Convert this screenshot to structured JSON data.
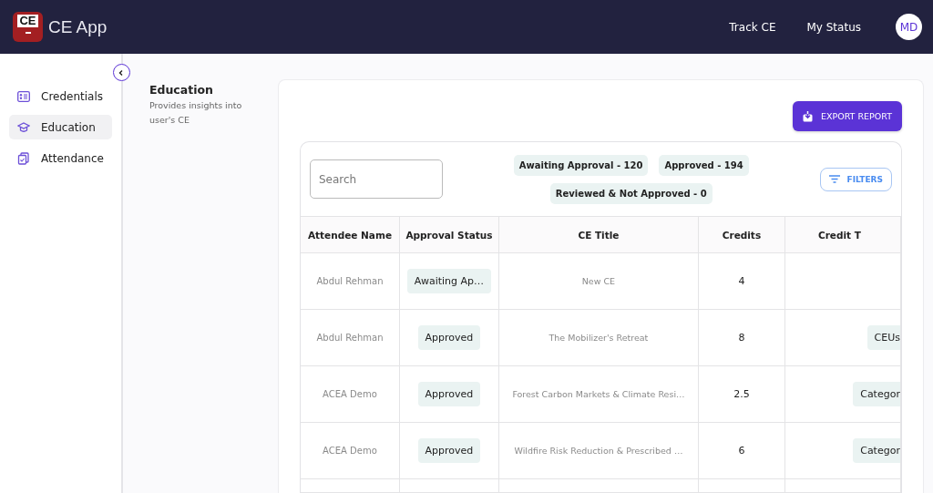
{
  "header": {
    "app_name": "CE App",
    "logo_text": "CE",
    "nav": [
      {
        "label": "Track CE"
      },
      {
        "label": "My Status"
      }
    ],
    "avatar": "MD"
  },
  "sidebar": {
    "items": [
      {
        "label": "Credentials",
        "selected": false
      },
      {
        "label": "Education",
        "selected": true
      },
      {
        "label": "Attendance",
        "selected": false
      }
    ]
  },
  "page": {
    "title": "Education",
    "subtitle": "Provides insights into user's CE"
  },
  "export_button": "EXPORT REPORT",
  "search": {
    "placeholder": "Search"
  },
  "status_counts": [
    "Awaiting Approval - 120",
    "Approved - 194",
    "Reviewed & Not Approved - 0"
  ],
  "filters_button": "FILTERS",
  "table": {
    "columns": [
      "Attendee Name",
      "Approval Status",
      "CE Title",
      "Credits",
      "Credit T"
    ],
    "rows": [
      {
        "attendee": "Abdul Rehman",
        "status": "Awaiting Ap…",
        "title": "New CE",
        "credits": "4"
      },
      {
        "attendee": "Abdul Rehman",
        "status": "Approved",
        "title": "The Mobilizer's Retreat",
        "credits": "8",
        "credit_type": "CEUs"
      },
      {
        "attendee": "ACEA Demo",
        "status": "Approved",
        "title": "Forest Carbon Markets & Climate Resi…",
        "credits": "2.5",
        "credit_type": "Categor"
      },
      {
        "attendee": "ACEA Demo",
        "status": "Approved",
        "title": "Wildfire Risk Reduction & Prescribed …",
        "credits": "6",
        "credit_type": "Categor"
      }
    ]
  }
}
